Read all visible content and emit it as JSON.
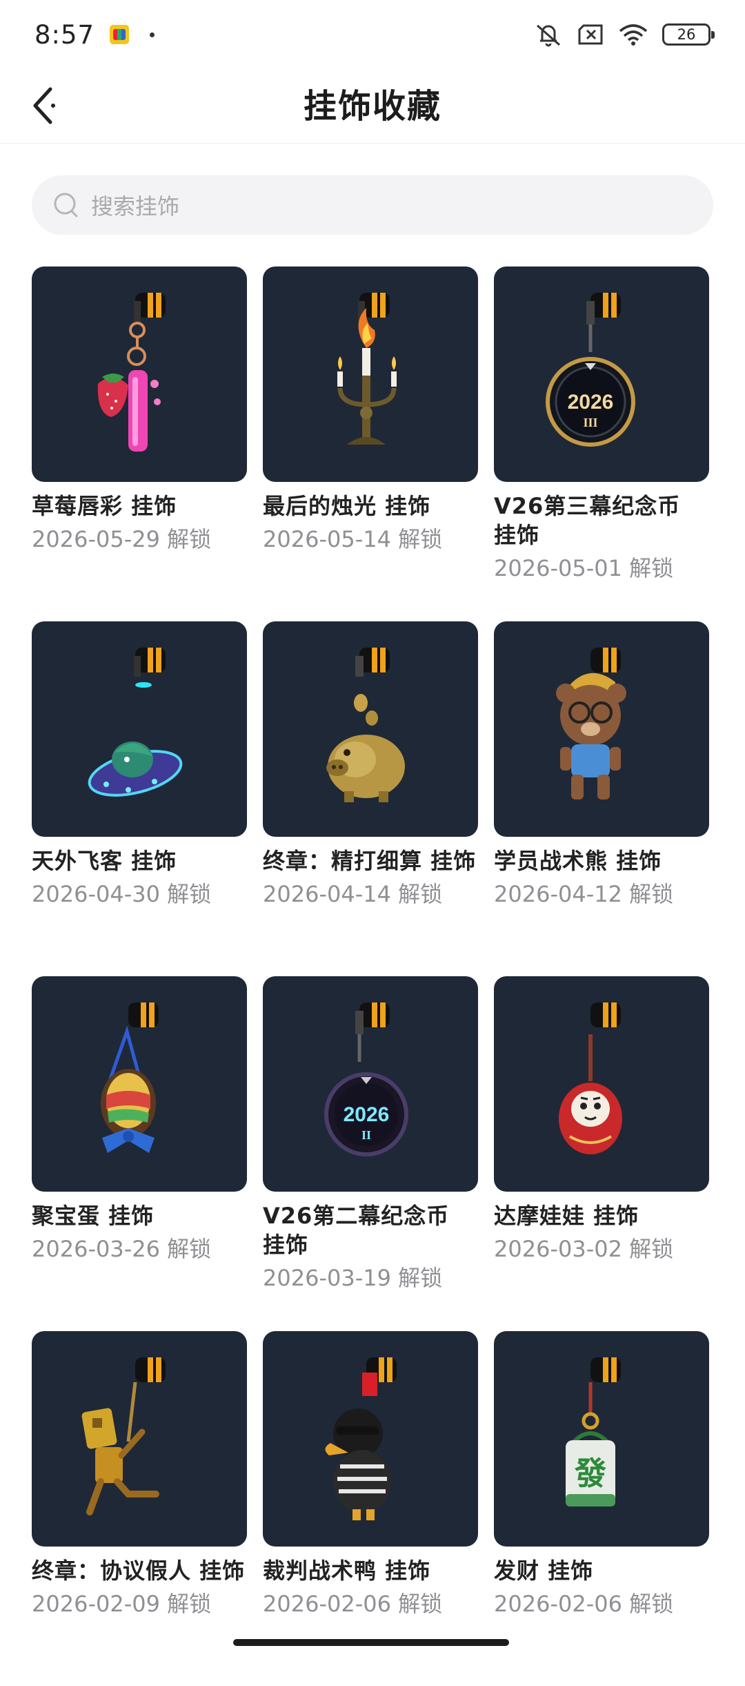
{
  "status_bar": {
    "time": "8:57",
    "battery": "26"
  },
  "nav": {
    "title": "挂饰收藏"
  },
  "search": {
    "placeholder": "搜索挂饰"
  },
  "items": [
    {
      "name": "草莓唇彩 挂饰",
      "date": "2026-05-29 解锁",
      "icon": "strawberry-lipgloss-charm"
    },
    {
      "name": "最后的烛光 挂饰",
      "date": "2026-05-14 解锁",
      "icon": "candelabra-charm"
    },
    {
      "name": "V26第三幕纪念币 挂饰",
      "date": "2026-05-01 解锁",
      "icon": "v26-act3-coin-charm"
    },
    {
      "name": "天外飞客 挂饰",
      "date": "2026-04-30 解锁",
      "icon": "ufo-charm"
    },
    {
      "name": "终章：精打细算 挂饰",
      "date": "2026-04-14 解锁",
      "icon": "piggy-bank-charm"
    },
    {
      "name": "学员战术熊 挂饰",
      "date": "2026-04-12 解锁",
      "icon": "cadet-bear-charm"
    },
    {
      "name": "聚宝蛋 挂饰",
      "date": "2026-03-26 解锁",
      "icon": "treasure-egg-charm"
    },
    {
      "name": "V26第二幕纪念币 挂饰",
      "date": "2026-03-19 解锁",
      "icon": "v26-act2-coin-charm"
    },
    {
      "name": "达摩娃娃 挂饰",
      "date": "2026-03-02 解锁",
      "icon": "daruma-charm"
    },
    {
      "name": "终章：协议假人 挂饰",
      "date": "2026-02-09 解锁",
      "icon": "dummy-charm"
    },
    {
      "name": "裁判战术鸭 挂饰",
      "date": "2026-02-06 解锁",
      "icon": "referee-duck-charm"
    },
    {
      "name": "发财 挂饰",
      "date": "2026-02-06 解锁",
      "icon": "mahjong-tile-charm"
    }
  ],
  "coin_labels": {
    "act3_year": "2026",
    "act3_numeral": "III",
    "act2_year": "2026",
    "act2_numeral": "II",
    "mahjong_glyph": "發"
  },
  "colors": {
    "tile_bg": "#1f2837",
    "accent_gold": "#f0a21b",
    "search_bg": "#f3f3f5"
  }
}
